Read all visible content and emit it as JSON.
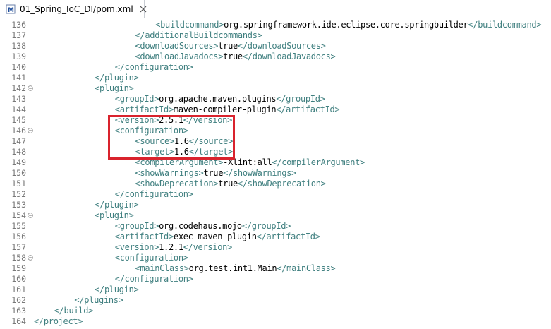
{
  "tab": {
    "title": "01_Spring_IoC_DI/pom.xml",
    "icon": "maven-xml-file-icon",
    "close_icon": "close-icon"
  },
  "colors": {
    "tag": "#3f7f7f",
    "text": "#000000",
    "line_number": "#787878",
    "highlight": "#d9232d"
  },
  "lines": [
    {
      "num": "136",
      "indent": 6,
      "fold": false,
      "open": "<buildcommand>",
      "text": "org.springframework.ide.eclipse.core.springbuilder",
      "close": "</buildcommand>"
    },
    {
      "num": "137",
      "indent": 5,
      "fold": false,
      "open": "</additionalBuildcommands>",
      "text": "",
      "close": ""
    },
    {
      "num": "138",
      "indent": 5,
      "fold": false,
      "open": "<downloadSources>",
      "text": "true",
      "close": "</downloadSources>"
    },
    {
      "num": "139",
      "indent": 5,
      "fold": false,
      "open": "<downloadJavadocs>",
      "text": "true",
      "close": "</downloadJavadocs>"
    },
    {
      "num": "140",
      "indent": 4,
      "fold": false,
      "open": "</configuration>",
      "text": "",
      "close": ""
    },
    {
      "num": "141",
      "indent": 3,
      "fold": false,
      "open": "</plugin>",
      "text": "",
      "close": ""
    },
    {
      "num": "142",
      "indent": 3,
      "fold": true,
      "open": "<plugin>",
      "text": "",
      "close": ""
    },
    {
      "num": "143",
      "indent": 4,
      "fold": false,
      "open": "<groupId>",
      "text": "org.apache.maven.plugins",
      "close": "</groupId>"
    },
    {
      "num": "144",
      "indent": 4,
      "fold": false,
      "open": "<artifactId>",
      "text": "maven-compiler-plugin",
      "close": "</artifactId>"
    },
    {
      "num": "145",
      "indent": 4,
      "fold": false,
      "open": "<version>",
      "text": "2.5.1",
      "close": "</version>"
    },
    {
      "num": "146",
      "indent": 4,
      "fold": true,
      "open": "<configuration>",
      "text": "",
      "close": ""
    },
    {
      "num": "147",
      "indent": 5,
      "fold": false,
      "open": "<source>",
      "text": "1.6",
      "close": "</source>"
    },
    {
      "num": "148",
      "indent": 5,
      "fold": false,
      "open": "<target>",
      "text": "1.6",
      "close": "</target>"
    },
    {
      "num": "149",
      "indent": 5,
      "fold": false,
      "open": "<compilerArgument>",
      "text": "-Xlint:all",
      "close": "</compilerArgument>"
    },
    {
      "num": "150",
      "indent": 5,
      "fold": false,
      "open": "<showWarnings>",
      "text": "true",
      "close": "</showWarnings>"
    },
    {
      "num": "151",
      "indent": 5,
      "fold": false,
      "open": "<showDeprecation>",
      "text": "true",
      "close": "</showDeprecation>"
    },
    {
      "num": "152",
      "indent": 4,
      "fold": false,
      "open": "</configuration>",
      "text": "",
      "close": ""
    },
    {
      "num": "153",
      "indent": 3,
      "fold": false,
      "open": "</plugin>",
      "text": "",
      "close": ""
    },
    {
      "num": "154",
      "indent": 3,
      "fold": true,
      "open": "<plugin>",
      "text": "",
      "close": ""
    },
    {
      "num": "155",
      "indent": 4,
      "fold": false,
      "open": "<groupId>",
      "text": "org.codehaus.mojo",
      "close": "</groupId>"
    },
    {
      "num": "156",
      "indent": 4,
      "fold": false,
      "open": "<artifactId>",
      "text": "exec-maven-plugin",
      "close": "</artifactId>"
    },
    {
      "num": "157",
      "indent": 4,
      "fold": false,
      "open": "<version>",
      "text": "1.2.1",
      "close": "</version>"
    },
    {
      "num": "158",
      "indent": 4,
      "fold": true,
      "open": "<configuration>",
      "text": "",
      "close": ""
    },
    {
      "num": "159",
      "indent": 5,
      "fold": false,
      "open": "<mainClass>",
      "text": "org.test.int1.Main",
      "close": "</mainClass>"
    },
    {
      "num": "160",
      "indent": 4,
      "fold": false,
      "open": "</configuration>",
      "text": "",
      "close": ""
    },
    {
      "num": "161",
      "indent": 3,
      "fold": false,
      "open": "</plugin>",
      "text": "",
      "close": ""
    },
    {
      "num": "162",
      "indent": 2,
      "fold": false,
      "open": "</plugins>",
      "text": "",
      "close": ""
    },
    {
      "num": "163",
      "indent": 1,
      "fold": false,
      "open": "</build>",
      "text": "",
      "close": ""
    },
    {
      "num": "164",
      "indent": 0,
      "fold": false,
      "open": "</project>",
      "text": "",
      "close": ""
    }
  ]
}
